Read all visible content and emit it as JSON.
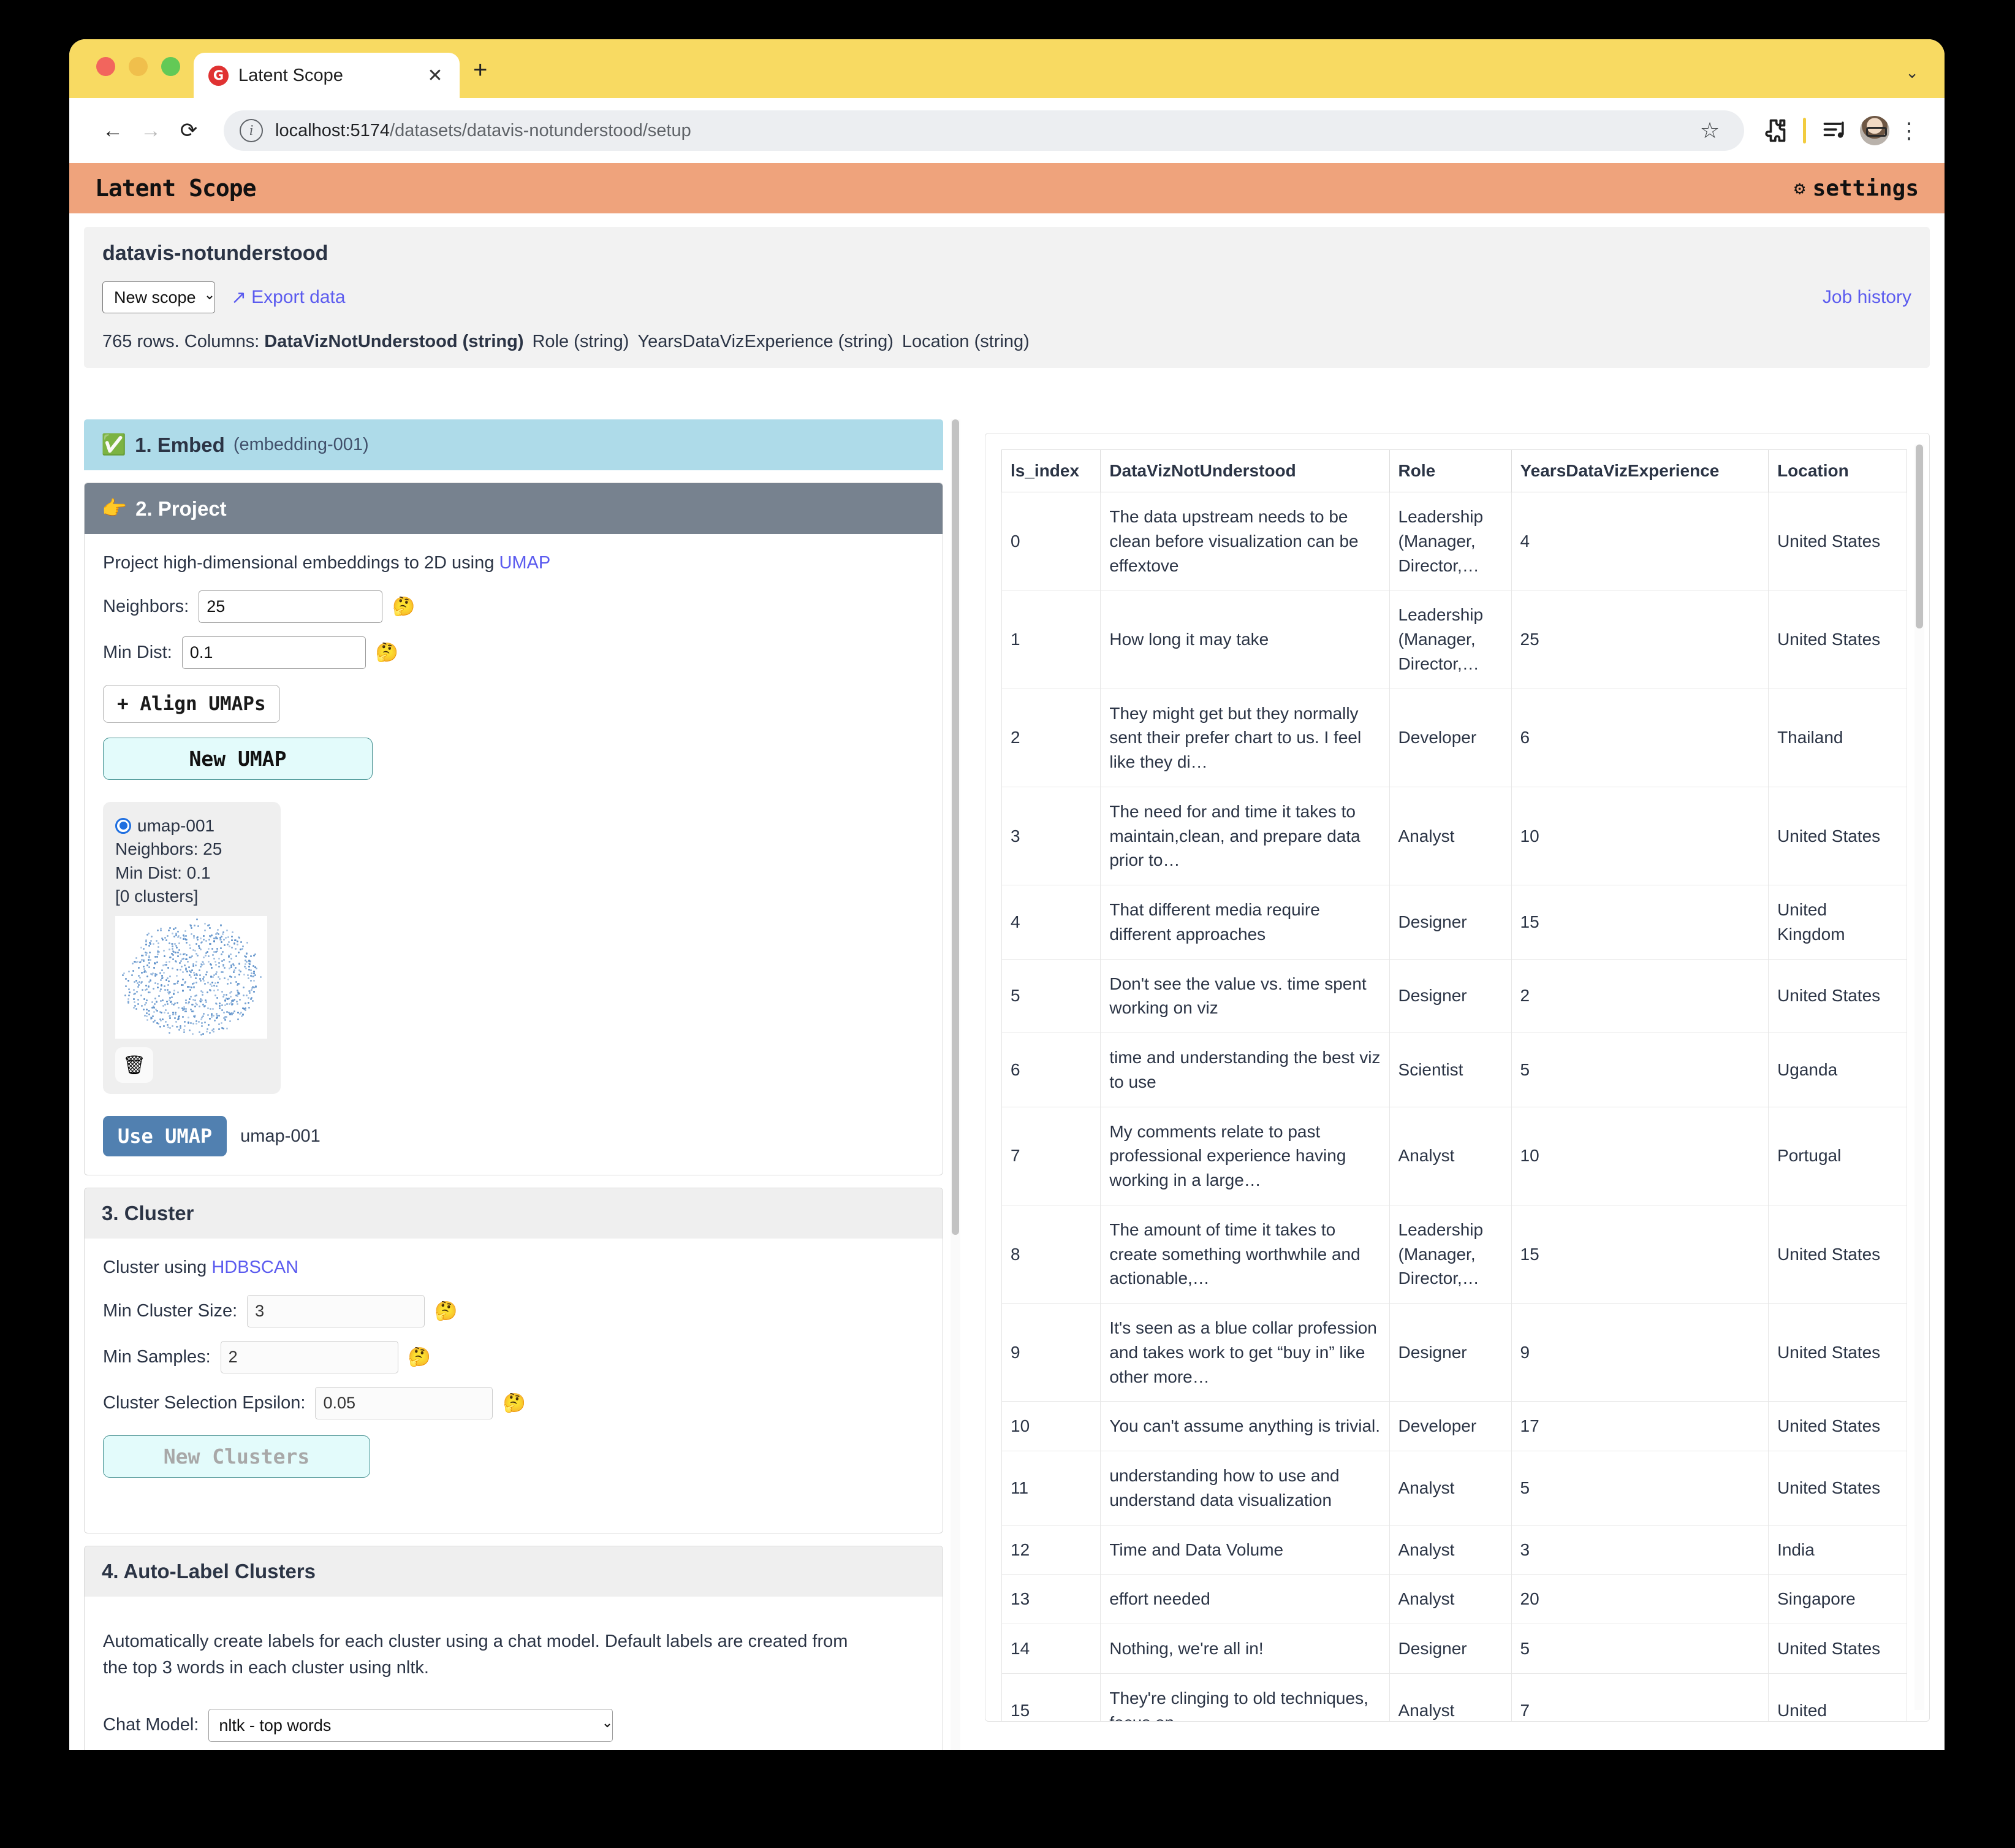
{
  "browser": {
    "tab_title": "Latent Scope",
    "favicon_letter": "G",
    "close_label": "✕",
    "new_tab_label": "+",
    "tabstrip_chevron": "⌄",
    "back_label": "←",
    "forward_label": "→",
    "reload_label": "⟳",
    "url_host": "localhost:5174",
    "url_path": "/datasets/datavis-notunderstood/setup",
    "star_label": "☆",
    "menu_label": "⋮"
  },
  "app": {
    "title": "Latent Scope",
    "settings_label": "settings",
    "gear_glyph": "⚙"
  },
  "dataset": {
    "name": "datavis-notunderstood",
    "scope_select_value": "New scope",
    "scope_options": [
      "New scope"
    ],
    "export_label": "Export data",
    "export_glyph": "↗",
    "job_history_label": "Job history",
    "rows_label": "765 rows. Columns:",
    "columns": [
      {
        "name": "DataVizNotUnderstood (string)",
        "primary": true
      },
      {
        "name": "Role (string)",
        "primary": false
      },
      {
        "name": "YearsDataVizExperience (string)",
        "primary": false
      },
      {
        "name": "Location (string)",
        "primary": false
      }
    ]
  },
  "steps": {
    "embed": {
      "icon": "✅",
      "title": "1. Embed",
      "subtitle": "(embedding-001)"
    },
    "project": {
      "icon": "👉",
      "title": "2. Project",
      "description_prefix": "Project high-dimensional embeddings to 2D using ",
      "description_link": "UMAP",
      "neighbors_label": "Neighbors:",
      "neighbors_value": "25",
      "min_dist_label": "Min Dist:",
      "min_dist_value": "0.1",
      "help_glyph": "🤔",
      "align_umaps_label": "+ Align UMAPs",
      "new_umap_label": "New UMAP",
      "umap_card": {
        "name": "umap-001",
        "neighbors": "Neighbors: 25",
        "min_dist": "Min Dist: 0.1",
        "clusters": "[0 clusters]",
        "delete_glyph": "🗑"
      },
      "use_umap_label": "Use UMAP",
      "use_umap_name": "umap-001"
    },
    "cluster": {
      "title": "3. Cluster",
      "description_prefix": "Cluster using ",
      "description_link": "HDBSCAN",
      "min_cluster_size_label": "Min Cluster Size:",
      "min_cluster_size_value": "3",
      "min_samples_label": "Min Samples:",
      "min_samples_value": "2",
      "epsilon_label": "Cluster Selection Epsilon:",
      "epsilon_value": "0.05",
      "help_glyph": "🤔",
      "new_clusters_label": "New Clusters"
    },
    "autolabel": {
      "title": "4. Auto-Label Clusters",
      "description": "Automatically create labels for each cluster using a chat model. Default labels are created from the top 3 words in each cluster using nltk.",
      "chat_model_label": "Chat Model:",
      "chat_model_value": "nltk - top words"
    }
  },
  "table": {
    "headers": [
      "ls_index",
      "DataVizNotUnderstood",
      "Role",
      "YearsDataVizExperience",
      "Location"
    ],
    "rows": [
      [
        "0",
        "The data upstream needs to be clean before visualization can be effextove",
        "Leadership (Manager, Director,…",
        "4",
        "United States"
      ],
      [
        "1",
        "How long it may take",
        "Leadership (Manager, Director,…",
        "25",
        "United States"
      ],
      [
        "2",
        "They might get but they normally sent their prefer chart to us. I feel like they di…",
        "Developer",
        "6",
        "Thailand"
      ],
      [
        "3",
        "The need for and time it takes to maintain,clean, and prepare data prior to…",
        "Analyst",
        "10",
        "United States"
      ],
      [
        "4",
        "That different media require different approaches",
        "Designer",
        "15",
        "United Kingdom"
      ],
      [
        "5",
        "Don't see the value vs. time spent working on viz",
        "Designer",
        "2",
        "United States"
      ],
      [
        "6",
        "time and understanding the best viz to use",
        "Scientist",
        "5",
        "Uganda"
      ],
      [
        "7",
        "My comments relate to past professional experience having working in a large…",
        "Analyst",
        "10",
        "Portugal"
      ],
      [
        "8",
        "The amount of time it takes to create something worthwhile and actionable,…",
        "Leadership (Manager, Director,…",
        "15",
        "United States"
      ],
      [
        "9",
        "It's seen as a blue collar profession and takes work to get “buy in” like other more…",
        "Designer",
        "9",
        "United States"
      ],
      [
        "10",
        "You can't assume anything is trivial.",
        "Developer",
        "17",
        "United States"
      ],
      [
        "11",
        "understanding how to use and understand data visualization",
        "Analyst",
        "5",
        "United States"
      ],
      [
        "12",
        "Time and Data Volume",
        "Analyst",
        "3",
        "India"
      ],
      [
        "13",
        "effort needed",
        "Analyst",
        "20",
        "Singapore"
      ],
      [
        "14",
        "Nothing, we're all in!",
        "Designer",
        "5",
        "United States"
      ],
      [
        "15",
        "They're clinging to old techniques, focus on",
        "Analyst",
        "7",
        "United"
      ]
    ]
  },
  "colors": {
    "app_header": "#efa37c",
    "embed_step": "#aedbe9",
    "project_step": "#77828f",
    "link": "#5b5bef",
    "use_umap_button": "#5180b0",
    "cyan_button": "#e3fbfb",
    "tab_strip": "#f8da62"
  }
}
